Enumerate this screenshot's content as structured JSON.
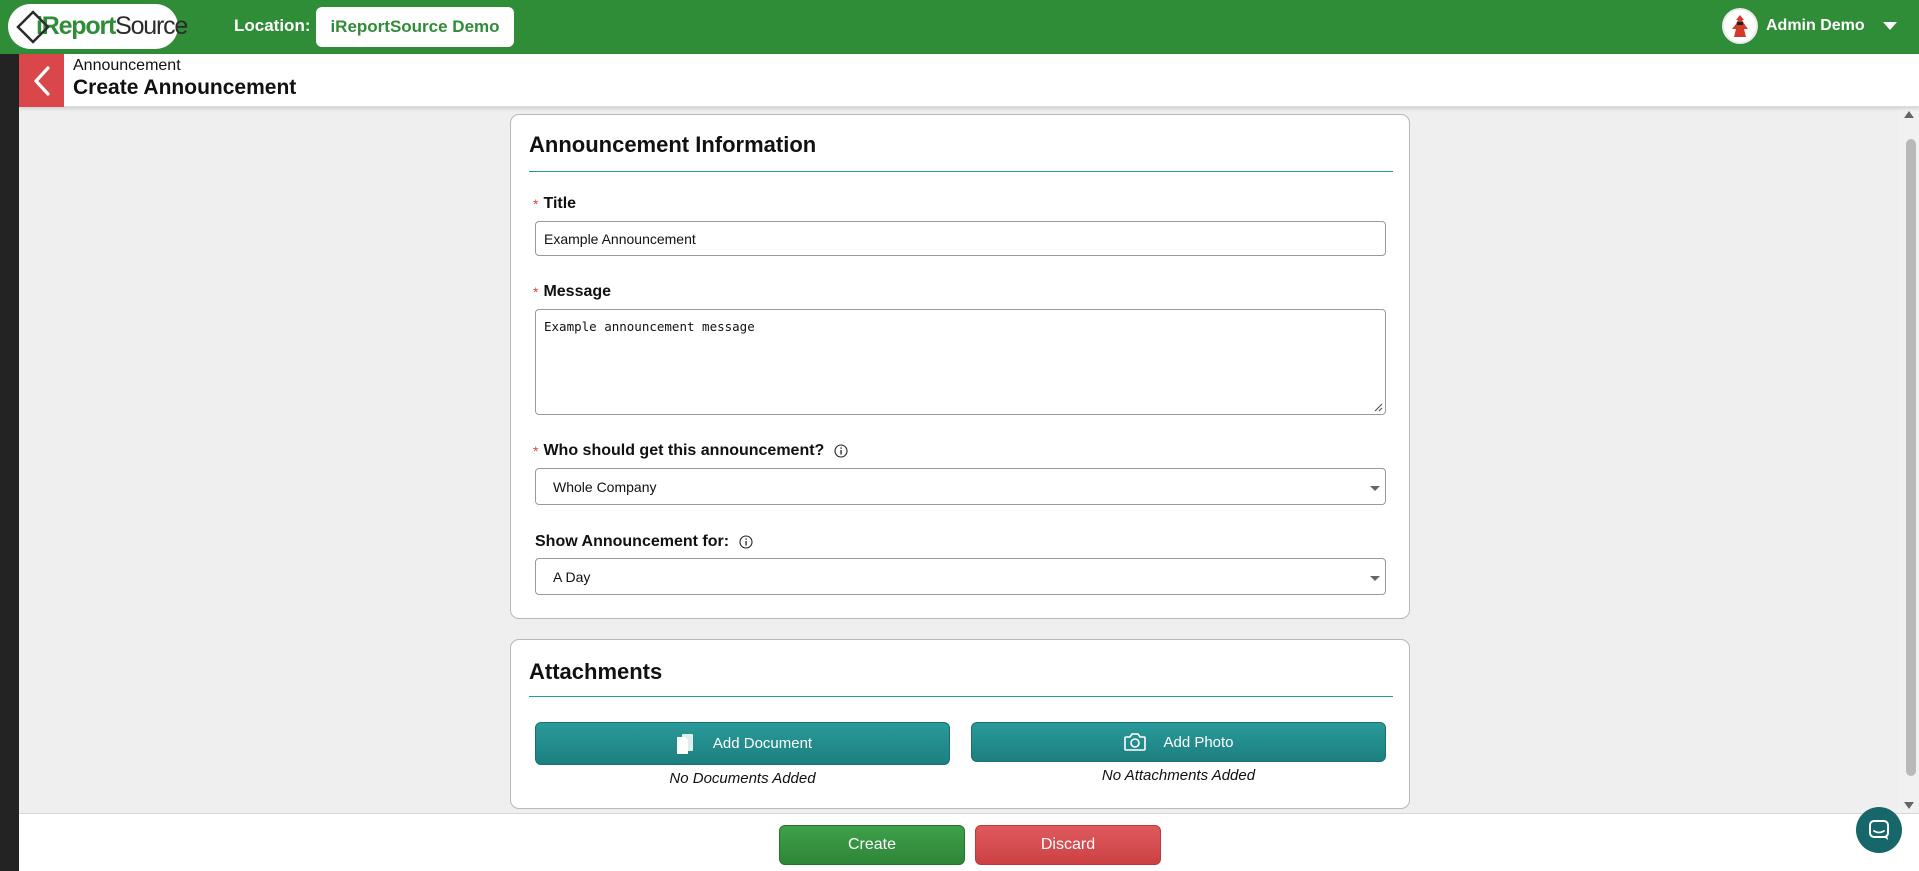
{
  "topbar": {
    "logo_text_prefix": "i",
    "logo_text_report": "Report",
    "logo_text_source": "Source",
    "location_label": "Location:",
    "location_value": "iReportSource Demo",
    "user_name": "Admin Demo",
    "brand_color": "#2f8c37"
  },
  "header": {
    "breadcrumb": "Announcement",
    "title": "Create Announcement"
  },
  "announcement_info": {
    "section_title": "Announcement Information",
    "title_label": "Title",
    "title_value": "Example Announcement",
    "message_label": "Message",
    "message_value": "Example announcement message",
    "recipients_label": "Who should get this announcement?",
    "recipients_value": "Whole Company",
    "duration_label": "Show Announcement for:",
    "duration_value": "A Day",
    "required_marker": "*"
  },
  "attachments": {
    "section_title": "Attachments",
    "add_document_label": "Add Document",
    "add_photo_label": "Add Photo",
    "no_documents_text": "No Documents Added",
    "no_attachments_text": "No Attachments Added",
    "accent_color": "#1f8a8a"
  },
  "actions": {
    "create_label": "Create",
    "discard_label": "Discard",
    "create_color": "#3a974a",
    "discard_color": "#d84e50"
  },
  "icons": {
    "back": "chevron-left-icon",
    "info": "info-icon",
    "document": "document-icon",
    "camera": "camera-icon",
    "chat": "chat-icon",
    "dropdown": "chevron-down-icon"
  }
}
